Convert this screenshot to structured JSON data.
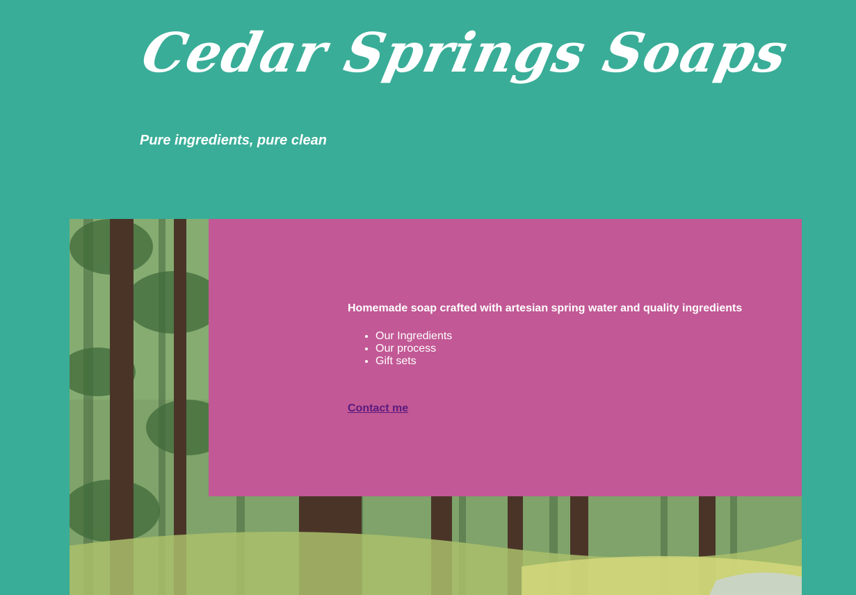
{
  "header": {
    "title": "Cedar Springs Soaps",
    "tagline": "Pure ingredients, pure clean"
  },
  "main": {
    "intro": "Homemade soap crafted with artesian spring water and quality ingredients",
    "menu": [
      {
        "label": "Our Ingredients"
      },
      {
        "label": "Our process"
      },
      {
        "label": "Gift sets"
      }
    ],
    "contact_label": "Contact me"
  },
  "colors": {
    "page_background": "#39ad98",
    "content_background": "#c25895",
    "text": "#ffffff",
    "link": "#5a1a7f"
  }
}
